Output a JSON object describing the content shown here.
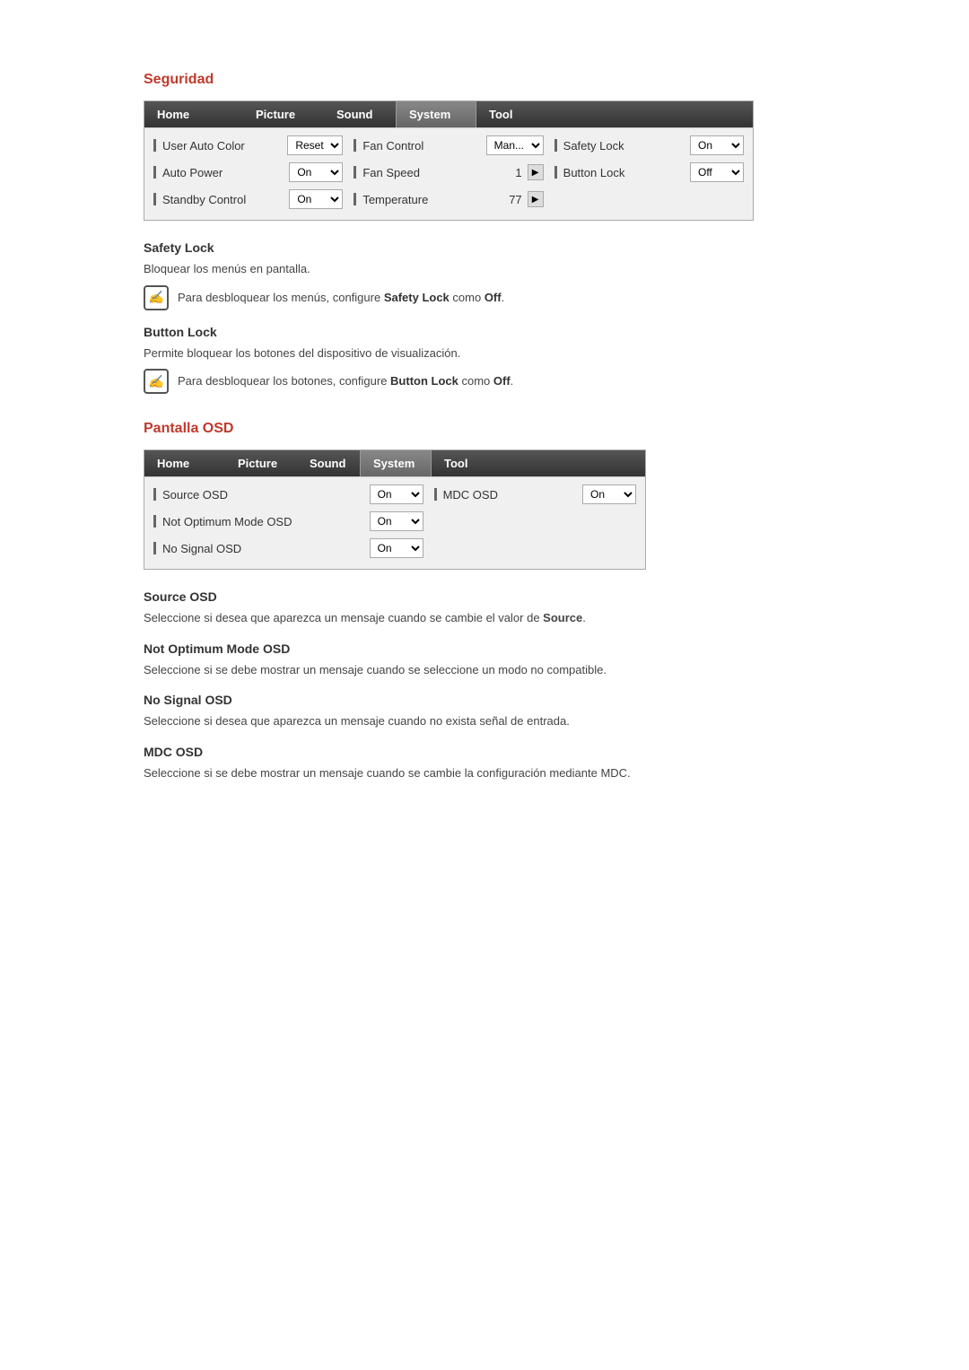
{
  "seguridad": {
    "title": "Seguridad",
    "table": {
      "tabs": [
        "Home",
        "Picture",
        "Sound",
        "System",
        "Tool"
      ],
      "active_tab": "System",
      "col1": [
        {
          "label": "User Auto Color",
          "control": "reset",
          "value": "Reset",
          "type": "dropdown"
        },
        {
          "label": "Auto Power",
          "control": "dropdown",
          "value": "On"
        },
        {
          "label": "Standby Control",
          "control": "dropdown",
          "value": "On"
        }
      ],
      "col2": [
        {
          "label": "Fan Control",
          "control": "dropdown",
          "value": "Man..."
        },
        {
          "label": "Fan Speed",
          "control": "arrow",
          "value": "1"
        },
        {
          "label": "Temperature",
          "control": "arrow",
          "value": "77"
        }
      ],
      "col3": [
        {
          "label": "Safety Lock",
          "control": "dropdown",
          "value": "On"
        },
        {
          "label": "Button Lock",
          "control": "dropdown",
          "value": "Off"
        }
      ]
    },
    "safety_lock": {
      "heading": "Safety Lock",
      "body": "Bloquear los menús en pantalla.",
      "note": "Para desbloquear los menús, configure Safety Lock como Off."
    },
    "button_lock": {
      "heading": "Button Lock",
      "body": "Permite bloquear los botones del dispositivo de visualización.",
      "note": "Para desbloquear los botones, configure Button Lock como Off."
    }
  },
  "pantalla_osd": {
    "title": "Pantalla OSD",
    "table": {
      "tabs": [
        "Home",
        "Picture",
        "Sound",
        "System",
        "Tool"
      ],
      "active_tab": "System",
      "col1": [
        {
          "label": "Source OSD",
          "control": "dropdown",
          "value": "On"
        },
        {
          "label": "Not Optimum Mode OSD",
          "control": "dropdown",
          "value": "On"
        },
        {
          "label": "No Signal OSD",
          "control": "dropdown",
          "value": "On"
        }
      ],
      "col2": [
        {
          "label": "MDC OSD",
          "control": "dropdown",
          "value": "On"
        }
      ]
    },
    "source_osd": {
      "heading": "Source OSD",
      "body": "Seleccione si desea que aparezca un mensaje cuando se cambie el valor de Source."
    },
    "not_optimum": {
      "heading": "Not Optimum Mode OSD",
      "body": "Seleccione si se debe mostrar un mensaje cuando se seleccione un modo no compatible."
    },
    "no_signal": {
      "heading": "No Signal OSD",
      "body": "Seleccione si desea que aparezca un mensaje cuando no exista señal de entrada."
    },
    "mdc_osd": {
      "heading": "MDC OSD",
      "body": "Seleccione si se debe mostrar un mensaje cuando se cambie la configuración mediante MDC."
    }
  },
  "icons": {
    "note": "✍",
    "arrow_right": "▶",
    "dropdown_arrow": "▼"
  }
}
